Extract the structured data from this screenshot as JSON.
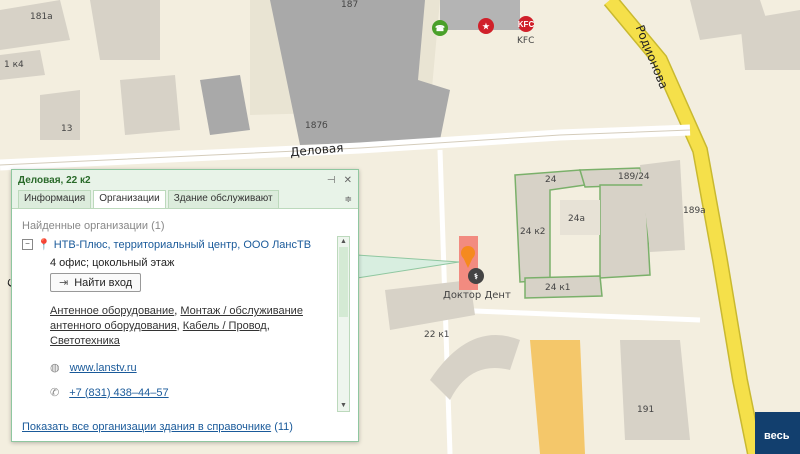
{
  "map": {
    "streets": [
      "Деловая",
      "Родионова",
      "Сандро"
    ],
    "building_numbers": [
      "181а",
      "187",
      "1 к4",
      "13",
      "187б",
      "189/24",
      "24",
      "24а",
      "24 к2",
      "24 к1",
      "22 к1",
      "189а",
      "191"
    ],
    "pois": [
      {
        "label": "KFC",
        "color": "#d0202a",
        "icon": "kfc-icon"
      },
      {
        "label": "",
        "color": "#d0202a",
        "icon": "star-icon"
      },
      {
        "label": "",
        "color": "#4aa02a",
        "icon": "phone-icon"
      },
      {
        "label": "Доктор Дент",
        "color": "#444444",
        "icon": "dentist-icon"
      }
    ]
  },
  "panel": {
    "title": "Деловая, 22 к2",
    "tabs": [
      "Информация",
      "Организации",
      "Здание обслуживают"
    ],
    "active_tab": "Организации",
    "found": "Найденные организации (1)",
    "org_name": "НТВ-Плюс, территориальный центр, ООО ЛансТВ",
    "address": "4 офис; цокольный этаж",
    "entry_button": "Найти вход",
    "categories": [
      "Антенное оборудование",
      "Монтаж / обслуживание антенного оборудования",
      "Кабель / Провод",
      "Светотехника"
    ],
    "website": "www.lanstv.ru",
    "phone": "+7 (831) 438–44–57",
    "footer_link": "Показать все организации здания в справочнике",
    "footer_count": "(11)"
  },
  "corner_button": "весь",
  "colors": {
    "accent": "#2a8a4a",
    "link": "#1a5a9a",
    "road_main": "#f5e04a",
    "selected_building": "#f28b80"
  }
}
